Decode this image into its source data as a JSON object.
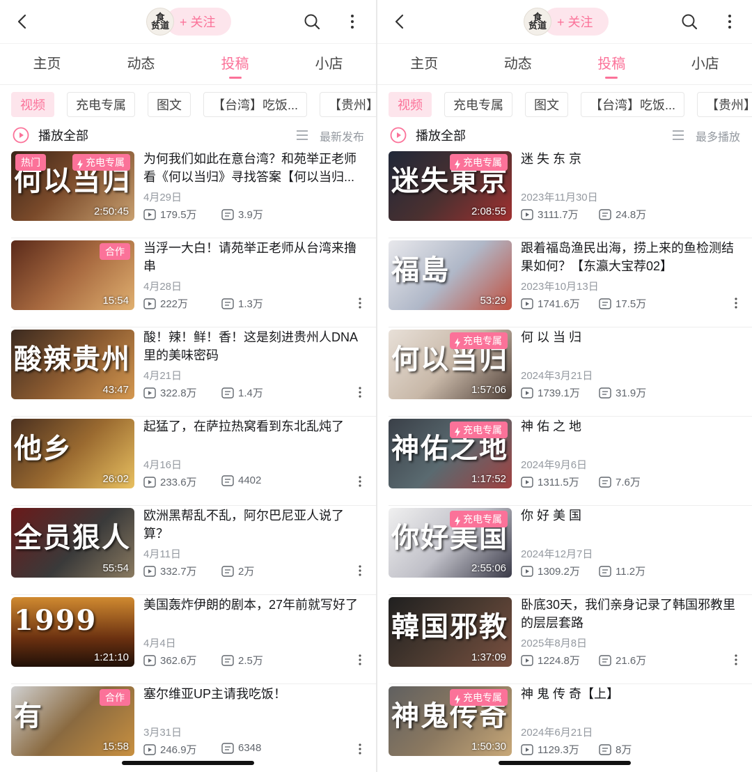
{
  "panels": [
    {
      "header": {
        "avatar_text": "食\n贫道",
        "follow_label": "+ 关注"
      },
      "tabs": [
        "主页",
        "动态",
        "投稿",
        "小店"
      ],
      "active_tab": 2,
      "chips": [
        "视频",
        "充电专属",
        "图文",
        "【台湾】吃饭...",
        "【贵州】"
      ],
      "play_all": "播放全部",
      "sort_label": "最新发布",
      "items": [
        {
          "title": "为何我们如此在意台湾？和苑举正老师看《何以当归》寻找答案【何以当归...",
          "date": "4月29日",
          "views": "179.5万",
          "danmaku": "3.9万",
          "duration": "2:50:45",
          "badge_left": "热门",
          "badge_right": "充电专属",
          "thumb_text": "何以当归",
          "thumb_bg": "linear-gradient(135deg,#3a2418 0%,#7a4a2a 45%,#c8a070 100%)",
          "show_more": false
        },
        {
          "title": "当浮一大白！请苑举正老师从台湾来撸串",
          "date": "4月28日",
          "views": "222万",
          "danmaku": "1.3万",
          "duration": "15:54",
          "badge_left": "",
          "badge_right": "合作",
          "thumb_text": "",
          "thumb_bg": "linear-gradient(135deg,#5a2a1a 0%,#a86a40 50%,#e0b070 100%)",
          "show_more": true
        },
        {
          "title": "酸！辣！鲜！香！这是刻进贵州人DNA里的美味密码",
          "date": "4月21日",
          "views": "322.8万",
          "danmaku": "1.4万",
          "duration": "43:47",
          "badge_left": "",
          "badge_right": "",
          "thumb_text": "酸辣贵州",
          "thumb_bg": "linear-gradient(135deg,#3b2a20 0%,#8a5a30 50%,#d49850 100%)",
          "show_more": true
        },
        {
          "title": "起猛了，在萨拉热窝看到东北乱炖了",
          "date": "4月16日",
          "views": "233.6万",
          "danmaku": "4402",
          "duration": "26:02",
          "badge_left": "",
          "badge_right": "",
          "thumb_text": "他乡",
          "thumb_bg": "linear-gradient(135deg,#4a3020 0%,#9a6a30 50%,#e8c060 100%)",
          "show_more": true
        },
        {
          "title": "欧洲黑帮乱不乱，阿尔巴尼亚人说了算？",
          "date": "4月11日",
          "views": "332.7万",
          "danmaku": "2万",
          "duration": "55:54",
          "badge_left": "",
          "badge_right": "",
          "thumb_text": "全员狠人",
          "thumb_bg": "linear-gradient(135deg,#6a1a1a 0%,#3a3a3a 55%,#8a7a60 100%)",
          "show_more": true
        },
        {
          "title": "美国轰炸伊朗的剧本，27年前就写好了",
          "date": "4月4日",
          "views": "362.6万",
          "danmaku": "2.5万",
          "duration": "1:21:10",
          "badge_left": "",
          "badge_right": "",
          "thumb_text": "1999",
          "thumb_bg": "linear-gradient(180deg,#d08a30 0%,#6a3010 60%,#201008 100%)",
          "show_more": true
        },
        {
          "title": "塞尔维亚UP主请我吃饭！",
          "date": "3月31日",
          "views": "246.9万",
          "danmaku": "6348",
          "duration": "15:58",
          "badge_left": "",
          "badge_right": "合作",
          "thumb_text": "有",
          "thumb_bg": "linear-gradient(135deg,#d0d0d0 0%,#8a6a40 50%,#c89040 100%)",
          "show_more": true
        }
      ]
    },
    {
      "header": {
        "avatar_text": "食\n贫道",
        "follow_label": "+ 关注"
      },
      "tabs": [
        "主页",
        "动态",
        "投稿",
        "小店"
      ],
      "active_tab": 2,
      "chips": [
        "视频",
        "充电专属",
        "图文",
        "【台湾】吃饭...",
        "【贵州】"
      ],
      "play_all": "播放全部",
      "sort_label": "最多播放",
      "items": [
        {
          "title": "迷 失 东 京",
          "date": "2023年11月30日",
          "views": "3111.7万",
          "danmaku": "24.8万",
          "duration": "2:08:55",
          "badge_left": "",
          "badge_right": "充电专属",
          "thumb_text": "迷失東京",
          "thumb_bg": "linear-gradient(135deg,#202838 0%,#4a3030 50%,#a03030 100%)",
          "show_more": false
        },
        {
          "title": "跟着福岛渔民出海，捞上来的鱼检测结果如何？【东瀛大宝荐02】",
          "date": "2023年10月13日",
          "views": "1741.6万",
          "danmaku": "17.5万",
          "duration": "53:29",
          "badge_left": "",
          "badge_right": "",
          "thumb_text": "福島",
          "thumb_bg": "linear-gradient(135deg,#e8e8ec 0%,#b0b8c8 50%,#c05040 100%)",
          "show_more": true
        },
        {
          "title": "何 以 当 归",
          "date": "2024年3月21日",
          "views": "1739.1万",
          "danmaku": "31.9万",
          "duration": "1:57:06",
          "badge_left": "",
          "badge_right": "充电专属",
          "thumb_text": "何以当归",
          "thumb_bg": "linear-gradient(135deg,#e8e0d8 0%,#c8b8a8 50%,#504038 100%)",
          "show_more": false
        },
        {
          "title": "神 佑 之 地",
          "date": "2024年9月6日",
          "views": "1311.5万",
          "danmaku": "7.6万",
          "duration": "1:17:52",
          "badge_left": "",
          "badge_right": "充电专属",
          "thumb_text": "神佑之地",
          "thumb_bg": "linear-gradient(135deg,#3a4048 0%,#5a6a70 50%,#a04040 100%)",
          "show_more": false
        },
        {
          "title": "你 好 美 国",
          "date": "2024年12月7日",
          "views": "1309.2万",
          "danmaku": "11.2万",
          "duration": "2:55:06",
          "badge_left": "",
          "badge_right": "充电专属",
          "thumb_text": "你好美国",
          "thumb_bg": "linear-gradient(135deg,#f0f0f0 0%,#c0c0c8 50%,#3a3a48 100%)",
          "show_more": false
        },
        {
          "title": "卧底30天，我们亲身记录了韩国邪教里的层层套路",
          "date": "2025年8月8日",
          "views": "1224.8万",
          "danmaku": "21.6万",
          "duration": "1:37:09",
          "badge_left": "",
          "badge_right": "",
          "thumb_text": "韓国邪教",
          "thumb_bg": "linear-gradient(135deg,#202020 0%,#4a3a30 50%,#7a5040 100%)",
          "show_more": true
        },
        {
          "title": "神 鬼 传 奇【上】",
          "date": "2024年6月21日",
          "views": "1129.3万",
          "danmaku": "8万",
          "duration": "1:50:30",
          "badge_left": "",
          "badge_right": "充电专属",
          "thumb_text": "神鬼传奇",
          "thumb_bg": "linear-gradient(135deg,#606060 0%,#8a7860 50%,#c8a878 100%)",
          "show_more": false
        }
      ]
    }
  ],
  "colors": {
    "accent": "#fb7299",
    "accent_bg": "#fde5ec",
    "muted": "#9499a0"
  },
  "icons": [
    "back-icon",
    "search-icon",
    "more-icon",
    "play-all-icon",
    "sort-icon",
    "view-count-icon",
    "danmaku-icon",
    "bolt-icon"
  ]
}
